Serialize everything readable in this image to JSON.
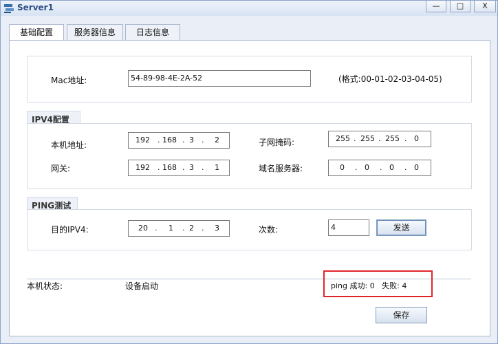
{
  "window": {
    "title": "Server1",
    "min_label": "—",
    "max_label": "□",
    "close_label": "X"
  },
  "tabs": [
    {
      "label": "基础配置"
    },
    {
      "label": "服务器信息"
    },
    {
      "label": "日志信息"
    }
  ],
  "mac": {
    "label": "Mac地址:",
    "value": "54-89-98-4E-2A-52",
    "hint": "(格式:00-01-02-03-04-05)"
  },
  "ipv4": {
    "legend": "IPV4配置",
    "local_label": "本机地址:",
    "local": [
      "192",
      "168",
      "3",
      "2"
    ],
    "mask_label": "子网掩码:",
    "mask": [
      "255",
      "255",
      "255",
      "0"
    ],
    "gateway_label": "网关:",
    "gateway": [
      "192",
      "168",
      "3",
      "1"
    ],
    "dns_label": "域名服务器:",
    "dns": [
      "0",
      "0",
      "0",
      "0"
    ]
  },
  "ping": {
    "legend": "PING测试",
    "target_label": "目的IPV4:",
    "target": [
      "20",
      "1",
      "2",
      "3"
    ],
    "count_label": "次数:",
    "count": "4",
    "send_label": "发送"
  },
  "status": {
    "label": "本机状态:",
    "value": "设备启动",
    "result": "ping 成功: 0   失败: 4"
  },
  "save_label": "保存",
  "accent": "#e0242a"
}
